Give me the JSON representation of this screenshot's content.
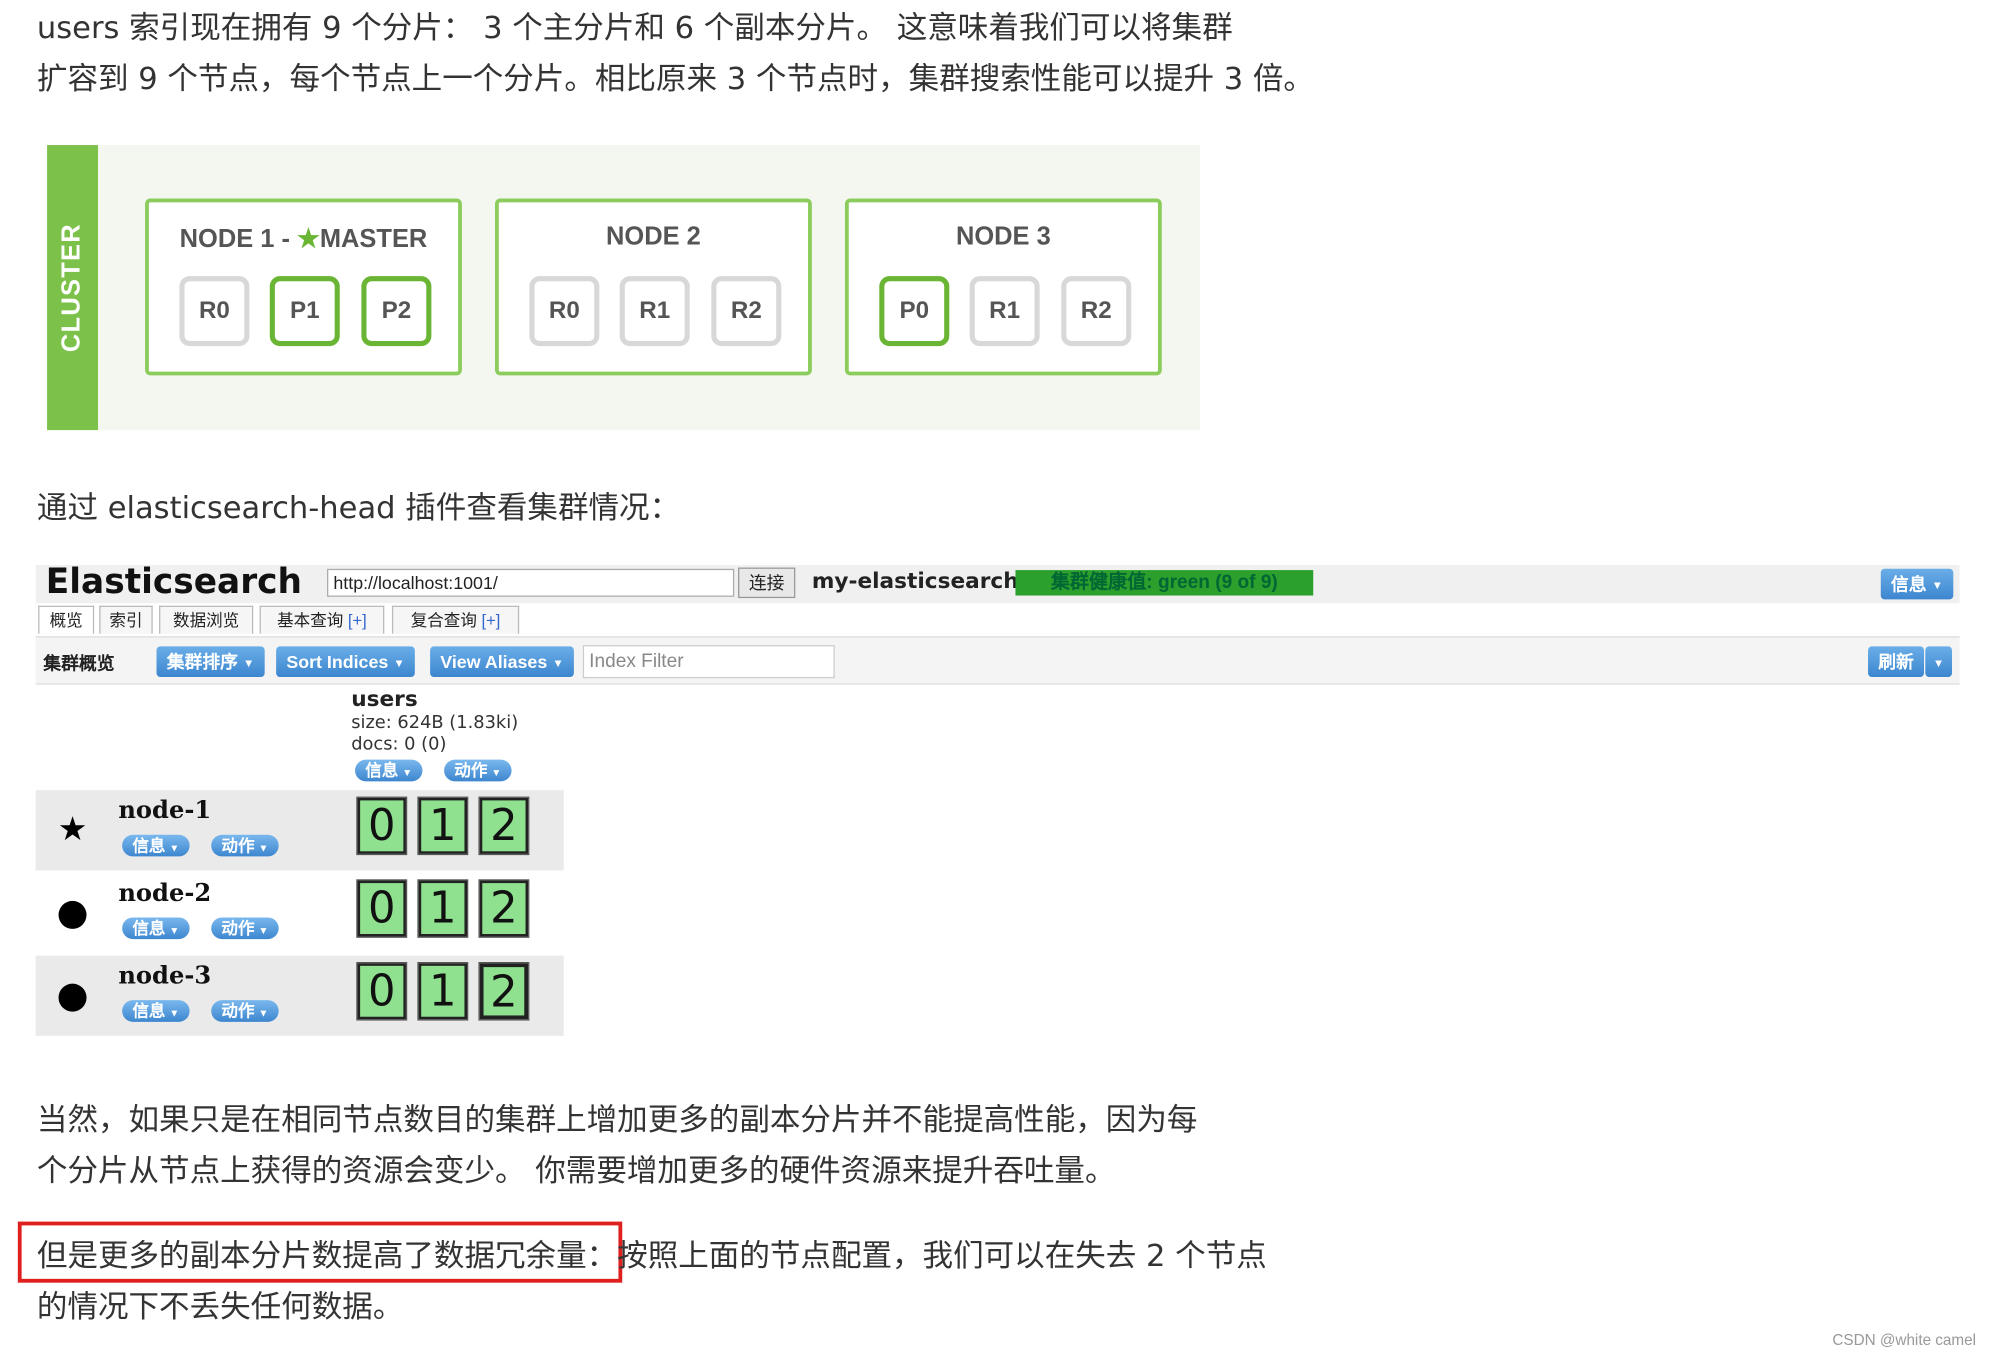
{
  "article": {
    "para1_line1": "users 索引现在拥有 9 个分片： 3 个主分片和 6 个副本分片。 这意味着我们可以将集群",
    "para1_line2": "扩容到 9 个节点，每个节点上一个分片。相比原来 3 个节点时，集群搜索性能可以提升 3 倍。",
    "para2": "通过 elasticsearch-head 插件查看集群情况：",
    "para3_line1": "当然，如果只是在相同节点数目的集群上增加更多的副本分片并不能提高性能，因为每",
    "para3_line2": "个分片从节点上获得的资源会变少。 你需要增加更多的硬件资源来提升吞吐量。",
    "para4_highlight": "但是更多的副本分片数提高了数据冗余量",
    "para4_rest": "：按照上面的节点配置，我们可以在失去 2 个节点",
    "para4_line2": "的情况下不丢失任何数据。",
    "watermark": "CSDN @white camel"
  },
  "cluster_diagram": {
    "label": "CLUSTER",
    "colors": {
      "accent": "#7cc24a",
      "primary_border": "#6ab534",
      "replica_border": "#d8d8d8"
    },
    "nodes": [
      {
        "title": "NODE 1 - ",
        "master_icon": "star-icon",
        "master": "MASTER",
        "shards": [
          {
            "label": "R0",
            "primary": false
          },
          {
            "label": "P1",
            "primary": true
          },
          {
            "label": "P2",
            "primary": true
          }
        ]
      },
      {
        "title": "NODE 2",
        "master": "",
        "shards": [
          {
            "label": "R0",
            "primary": false
          },
          {
            "label": "R1",
            "primary": false
          },
          {
            "label": "R2",
            "primary": false
          }
        ]
      },
      {
        "title": "NODE 3",
        "master": "",
        "shards": [
          {
            "label": "P0",
            "primary": true
          },
          {
            "label": "R1",
            "primary": false
          },
          {
            "label": "R2",
            "primary": false
          }
        ]
      }
    ]
  },
  "eshead": {
    "title": "Elasticsearch",
    "url": "http://localhost:1001/",
    "connect_label": "连接",
    "cluster_name": "my-elasticsearch",
    "health": "集群健康值: green (9 of 9)",
    "info_menu": "信息",
    "tabs": [
      {
        "label": "概览",
        "plus": ""
      },
      {
        "label": "索引",
        "plus": ""
      },
      {
        "label": "数据浏览",
        "plus": ""
      },
      {
        "label": "基本查询 ",
        "plus": "[+]"
      },
      {
        "label": "复合查询 ",
        "plus": "[+]"
      }
    ],
    "toolbar": {
      "overview_label": "集群概览",
      "sort_cluster": "集群排序",
      "sort_indices": "Sort Indices",
      "view_aliases": "View Aliases",
      "index_filter_placeholder": "Index Filter",
      "refresh": "刷新"
    },
    "index": {
      "name": "users",
      "size": "size: 624B (1.83ki)",
      "docs": "docs: 0 (0)",
      "info": "信息",
      "action": "动作"
    },
    "nodes": [
      {
        "name": "node-1",
        "icon": "star-icon",
        "info": "信息",
        "action": "动作",
        "shards": [
          "0",
          "1",
          "2"
        ],
        "primary_index": -1
      },
      {
        "name": "node-2",
        "icon": "dot-icon",
        "info": "信息",
        "action": "动作",
        "shards": [
          "0",
          "1",
          "2"
        ],
        "primary_index": -1
      },
      {
        "name": "node-3",
        "icon": "dot-icon",
        "info": "信息",
        "action": "动作",
        "shards": [
          "0",
          "1",
          "2"
        ],
        "primary_index": 2
      }
    ],
    "colors": {
      "shard_fill": "#8fe08f",
      "health_green": "#2ca02c",
      "button_blue": "#3d86cf"
    }
  }
}
